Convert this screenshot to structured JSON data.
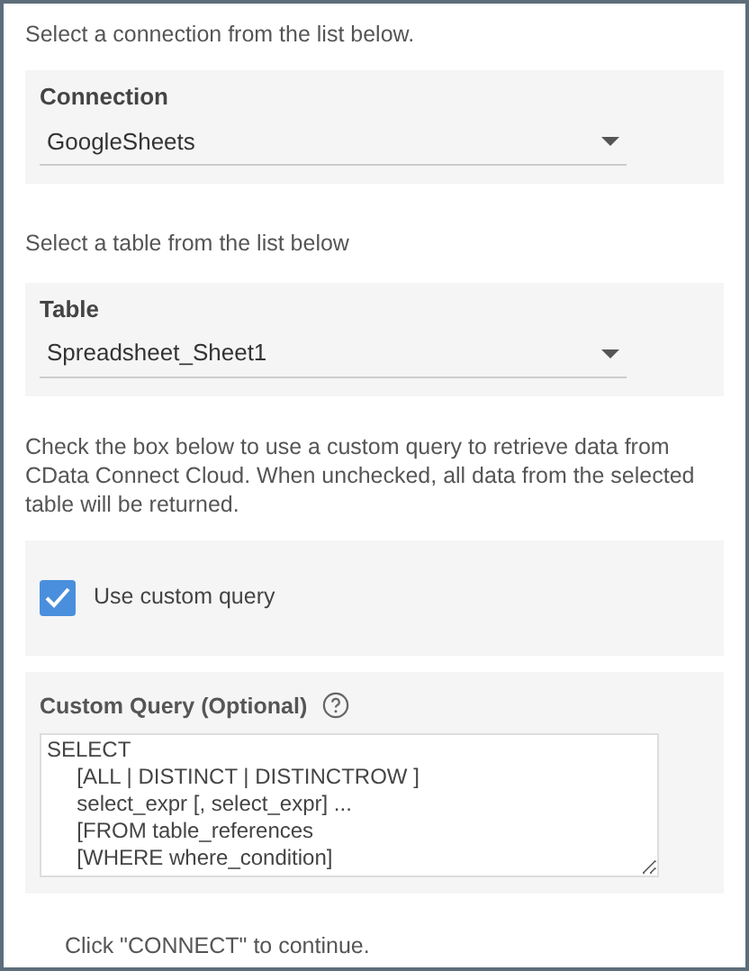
{
  "connection_prompt": "Select a connection from the list below.",
  "connection": {
    "label": "Connection",
    "value": "GoogleSheets"
  },
  "table_prompt": "Select a table from the list below",
  "table": {
    "label": "Table",
    "value": "Spreadsheet_Sheet1"
  },
  "custom_query_prompt": "Check the box below to use a custom query to retrieve data from CData Connect Cloud. When unchecked, all data from the selected table will be returned.",
  "use_custom_query": {
    "label": "Use custom query",
    "checked": true
  },
  "custom_query": {
    "label": "Custom Query (Optional)",
    "value": "SELECT\n     [ALL | DISTINCT | DISTINCTROW ]\n     select_expr [, select_expr] ...\n     [FROM table_references\n     [WHERE where_condition]"
  },
  "footer": "Click \"CONNECT\" to continue."
}
